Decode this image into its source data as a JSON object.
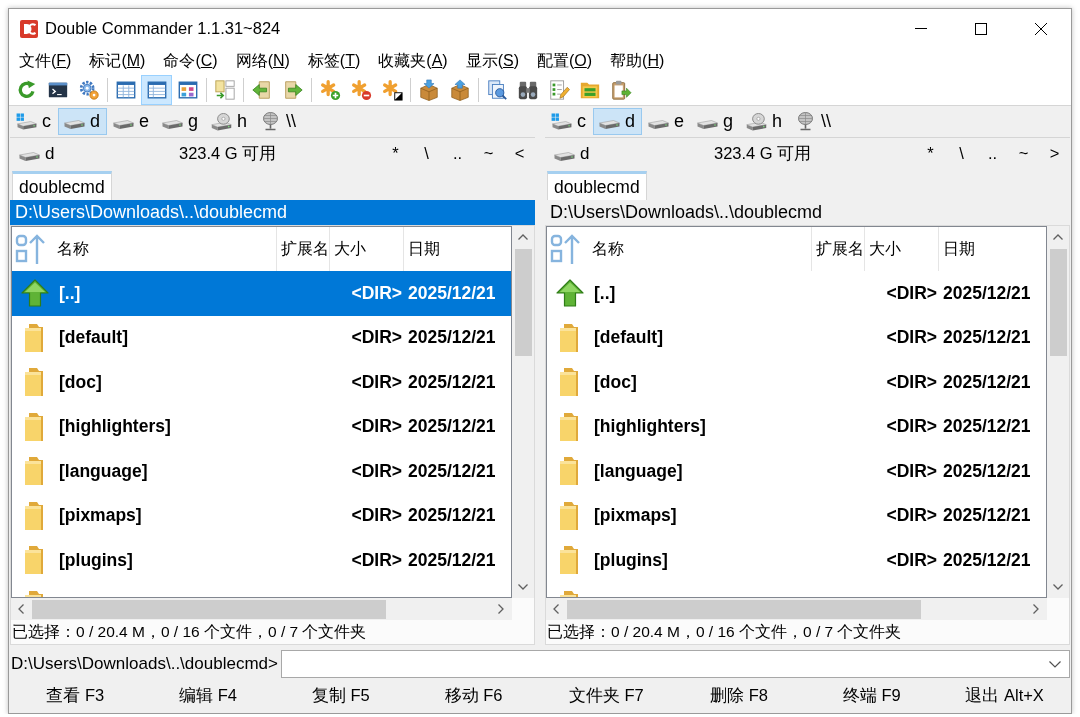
{
  "window": {
    "title": "Double Commander 1.1.31~824"
  },
  "menu": [
    {
      "prefix": "文件(",
      "key": "F",
      "suffix": ")"
    },
    {
      "prefix": "标记(",
      "key": "M",
      "suffix": ")"
    },
    {
      "prefix": "命令(",
      "key": "C",
      "suffix": ")"
    },
    {
      "prefix": "网络(",
      "key": "N",
      "suffix": ")"
    },
    {
      "prefix": "标签(",
      "key": "T",
      "suffix": ")"
    },
    {
      "prefix": "收藏夹(",
      "key": "A",
      "suffix": ")"
    },
    {
      "prefix": "显示(",
      "key": "S",
      "suffix": ")"
    },
    {
      "prefix": "配置(",
      "key": "O",
      "suffix": ")"
    },
    {
      "prefix": "帮助(",
      "key": "H",
      "suffix": ")"
    }
  ],
  "toolbar": [
    [
      {
        "selected": false
      },
      {
        "selected": false
      },
      {
        "selected": false
      }
    ],
    [
      {
        "selected": false
      },
      {
        "selected": true
      },
      {
        "selected": false
      }
    ],
    [
      {
        "selected": false
      }
    ],
    [
      {
        "selected": false
      },
      {
        "selected": false
      }
    ],
    [
      {
        "selected": false
      },
      {
        "selected": false
      },
      {
        "selected": false
      }
    ],
    [
      {
        "selected": false
      },
      {
        "selected": false
      }
    ],
    [
      {
        "selected": false
      },
      {
        "selected": false
      },
      {
        "selected": false
      },
      {
        "selected": false
      },
      {
        "selected": false
      }
    ]
  ],
  "panels": [
    {
      "active": true,
      "drives": [
        {
          "letter": "c",
          "kind": "system",
          "selected": false
        },
        {
          "letter": "d",
          "kind": "disk",
          "selected": true
        },
        {
          "letter": "e",
          "kind": "disk",
          "selected": false
        },
        {
          "letter": "g",
          "kind": "disk",
          "selected": false
        },
        {
          "letter": "h",
          "kind": "optical",
          "selected": false
        },
        {
          "letter": "\\\\",
          "kind": "network",
          "selected": false
        }
      ],
      "current_drive": {
        "letter": "d",
        "kind": "disk"
      },
      "free_space": "323.4 G 可用",
      "nav_buttons": [
        "*",
        "\\",
        "..",
        "~",
        "<"
      ],
      "tabs": [
        {
          "label": "doublecmd",
          "selected": true
        }
      ],
      "path": "D:\\Users\\Downloads\\..\\doublecmd",
      "columns": [
        {
          "label": "名称",
          "sorted": true
        },
        {
          "label": "扩展名",
          "sorted": false
        },
        {
          "label": "大小",
          "sorted": false
        },
        {
          "label": "日期",
          "sorted": false
        }
      ],
      "rows": [
        {
          "kind": "parent",
          "name": "[..]",
          "size": "<DIR>",
          "date": "2025/12/21",
          "selected": true
        },
        {
          "kind": "folder",
          "name": "[default]",
          "size": "<DIR>",
          "date": "2025/12/21",
          "selected": false
        },
        {
          "kind": "folder",
          "name": "[doc]",
          "size": "<DIR>",
          "date": "2025/12/21",
          "selected": false
        },
        {
          "kind": "folder",
          "name": "[highlighters]",
          "size": "<DIR>",
          "date": "2025/12/21",
          "selected": false
        },
        {
          "kind": "folder",
          "name": "[language]",
          "size": "<DIR>",
          "date": "2025/12/21",
          "selected": false
        },
        {
          "kind": "folder",
          "name": "[pixmaps]",
          "size": "<DIR>",
          "date": "2025/12/21",
          "selected": false
        },
        {
          "kind": "folder",
          "name": "[plugins]",
          "size": "<DIR>",
          "date": "2025/12/21",
          "selected": false
        },
        {
          "kind": "folder",
          "selected": false
        }
      ],
      "status": "已选择：0 / 20.4 M，0 / 16 个文件，0 / 7 个文件夹"
    },
    {
      "active": false,
      "drives": [
        {
          "letter": "c",
          "kind": "system",
          "selected": false
        },
        {
          "letter": "d",
          "kind": "disk",
          "selected": true
        },
        {
          "letter": "e",
          "kind": "disk",
          "selected": false
        },
        {
          "letter": "g",
          "kind": "disk",
          "selected": false
        },
        {
          "letter": "h",
          "kind": "optical",
          "selected": false
        },
        {
          "letter": "\\\\",
          "kind": "network",
          "selected": false
        }
      ],
      "current_drive": {
        "letter": "d",
        "kind": "disk"
      },
      "free_space": "323.4 G 可用",
      "nav_buttons": [
        "*",
        "\\",
        "..",
        "~",
        ">"
      ],
      "tabs": [
        {
          "label": "doublecmd",
          "selected": true
        }
      ],
      "path": "D:\\Users\\Downloads\\..\\doublecmd",
      "columns": [
        {
          "label": "名称",
          "sorted": true
        },
        {
          "label": "扩展名",
          "sorted": false
        },
        {
          "label": "大小",
          "sorted": false
        },
        {
          "label": "日期",
          "sorted": false
        }
      ],
      "rows": [
        {
          "kind": "parent",
          "name": "[..]",
          "size": "<DIR>",
          "date": "2025/12/21",
          "selected": false
        },
        {
          "kind": "folder",
          "name": "[default]",
          "size": "<DIR>",
          "date": "2025/12/21",
          "selected": false
        },
        {
          "kind": "folder",
          "name": "[doc]",
          "size": "<DIR>",
          "date": "2025/12/21",
          "selected": false
        },
        {
          "kind": "folder",
          "name": "[highlighters]",
          "size": "<DIR>",
          "date": "2025/12/21",
          "selected": false
        },
        {
          "kind": "folder",
          "name": "[language]",
          "size": "<DIR>",
          "date": "2025/12/21",
          "selected": false
        },
        {
          "kind": "folder",
          "name": "[pixmaps]",
          "size": "<DIR>",
          "date": "2025/12/21",
          "selected": false
        },
        {
          "kind": "folder",
          "name": "[plugins]",
          "size": "<DIR>",
          "date": "2025/12/21",
          "selected": false
        },
        {
          "kind": "folder",
          "selected": false
        }
      ],
      "status": "已选择：0 / 20.4 M，0 / 16 个文件，0 / 7 个文件夹"
    }
  ],
  "command_line": {
    "prompt": "D:\\Users\\Downloads\\..\\doublecmd>"
  },
  "function_keys": [
    "查看 F3",
    "编辑 F4",
    "复制 F5",
    "移动 F6",
    "文件夹 F7",
    "删除 F8",
    "终端 F9",
    "退出 Alt+X"
  ]
}
